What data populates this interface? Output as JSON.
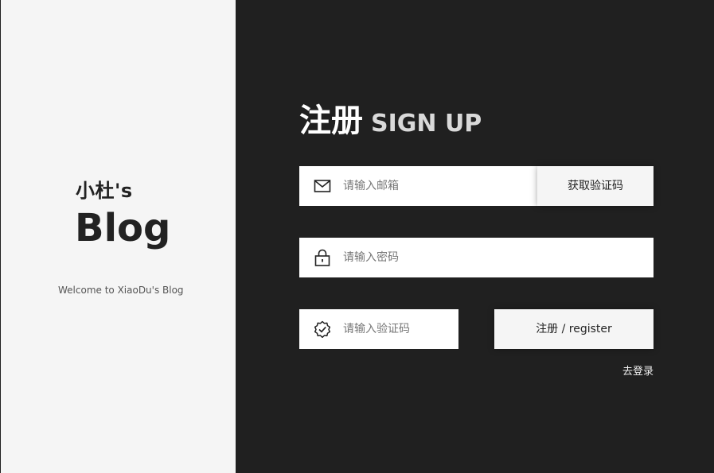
{
  "brand": {
    "name_small": "小杜's",
    "name_big": "Blog",
    "welcome": "Welcome to XiaoDu's Blog"
  },
  "form": {
    "title_cn": "注册",
    "title_en": "SIGN UP",
    "email": {
      "placeholder": "请输入邮箱",
      "value": "",
      "icon": "mail-icon"
    },
    "get_code_label": "获取验证码",
    "password": {
      "placeholder": "请输入密码",
      "value": "",
      "icon": "lock-icon"
    },
    "code": {
      "placeholder": "请输入验证码",
      "value": "",
      "icon": "verified-badge-icon"
    },
    "register_label": "注册 / register",
    "goto_login_label": "去登录"
  },
  "colors": {
    "dark_bg": "#202020",
    "light_panel": "#f5f5f5",
    "input_bg": "#ffffff",
    "button_bg": "#f5f5f5"
  }
}
